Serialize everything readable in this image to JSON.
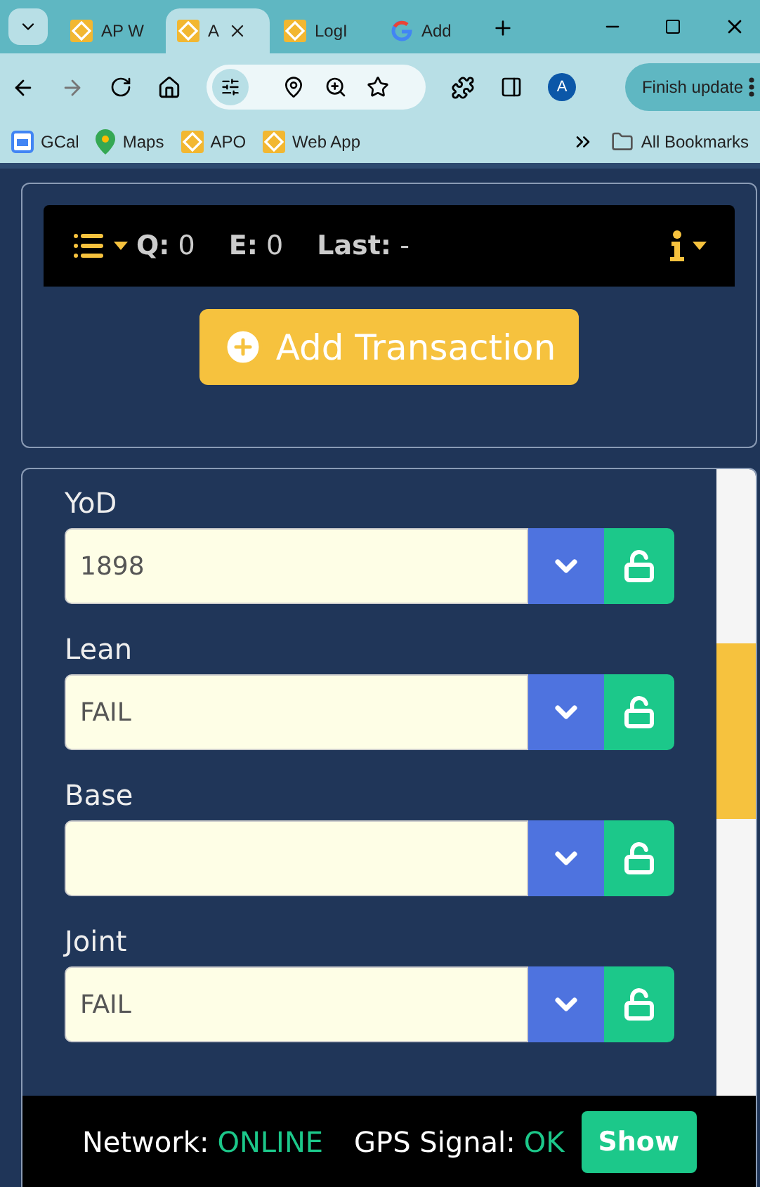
{
  "browser": {
    "tabs": [
      {
        "title": "AP W",
        "kind": "app",
        "selected": false
      },
      {
        "title": "A",
        "kind": "app",
        "selected": true
      },
      {
        "title": "LogI",
        "kind": "app",
        "selected": false
      },
      {
        "title": "Add",
        "kind": "google",
        "selected": false
      }
    ],
    "profile": "A",
    "update_button": "Finish update",
    "bookmarks": [
      {
        "label": "GCal",
        "kind": "calendar"
      },
      {
        "label": "Maps",
        "kind": "maps"
      },
      {
        "label": "APO",
        "kind": "app"
      },
      {
        "label": "Web App",
        "kind": "app"
      }
    ],
    "all_bookmarks": "All Bookmarks"
  },
  "app": {
    "status": {
      "queue_label": "Q:",
      "queue": "0",
      "errors_label": "E:",
      "errors": "0",
      "last_label": "Last:",
      "last": "-"
    },
    "add_button": "Add Transaction",
    "fields": [
      {
        "label": "YoD",
        "value": "1898",
        "locked": false
      },
      {
        "label": "Lean",
        "value": "FAIL",
        "locked": false
      },
      {
        "label": "Base",
        "locked": false
      },
      {
        "label": "Joint",
        "value": "FAIL",
        "locked": false
      }
    ],
    "footer": {
      "network_label": "Network:",
      "network": "ONLINE",
      "gps_label": "GPS Signal:",
      "gps": "OK",
      "show_button": "Show"
    }
  }
}
